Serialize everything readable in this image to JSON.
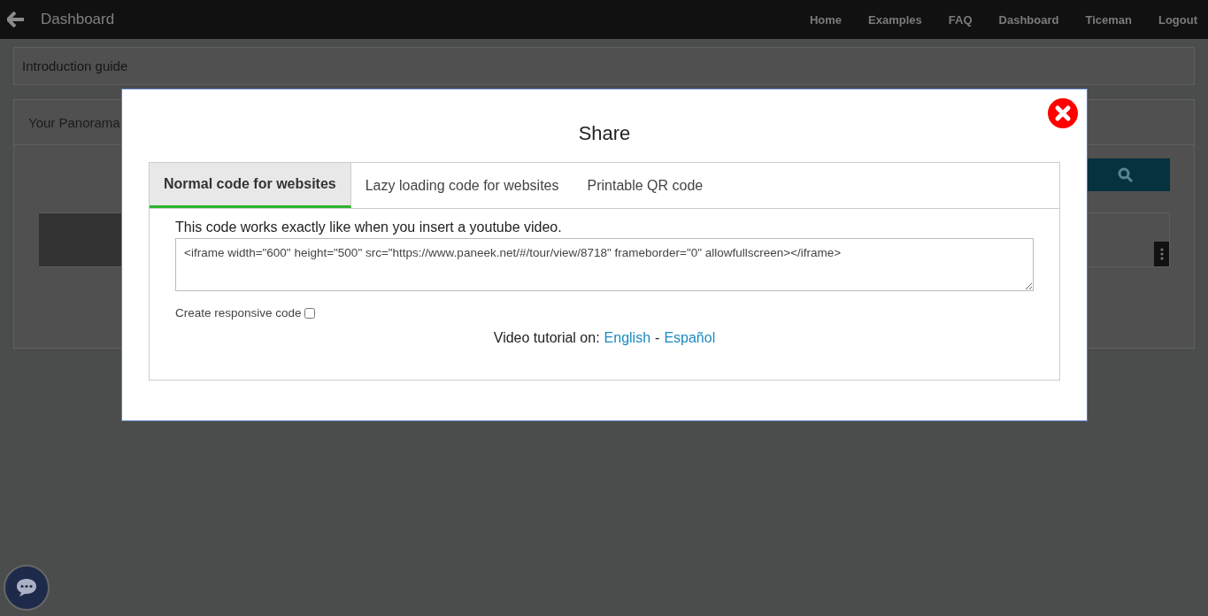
{
  "topbar": {
    "title": "Dashboard",
    "nav": [
      "Home",
      "Examples",
      "FAQ",
      "Dashboard",
      "Ticeman",
      "Logout"
    ]
  },
  "page": {
    "intro_title": "Introduction guide",
    "panorama_title": "Your Panorama"
  },
  "modal": {
    "title": "Share",
    "tabs": [
      {
        "label": "Normal code for websites",
        "selected": true
      },
      {
        "label": "Lazy loading code for websites",
        "selected": false
      },
      {
        "label": "Printable QR code",
        "selected": false
      }
    ],
    "description": "This code works exactly like when you insert a youtube video.",
    "code": "<iframe width=\"600\" height=\"500\" src=\"https://www.paneek.net/#/tour/view/8718\" frameborder=\"0\" allowfullscreen></iframe>",
    "responsive": {
      "label": "Create responsive code",
      "checked": false
    },
    "tutorial": {
      "label": "Video tutorial on:",
      "separator": "-",
      "links": [
        "English",
        "Español"
      ]
    }
  }
}
